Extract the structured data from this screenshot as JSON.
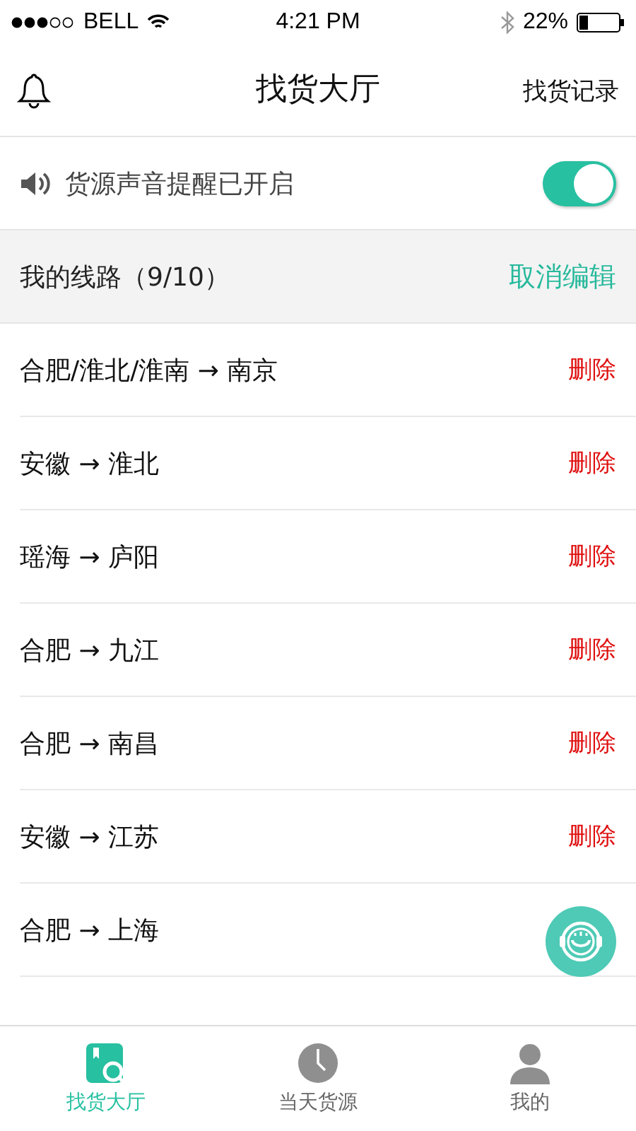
{
  "status_bar": {
    "carrier": "BELL",
    "time": "4:21 PM",
    "battery": "22%"
  },
  "nav": {
    "title": "找货大厅",
    "action": "找货记录"
  },
  "sound_setting": {
    "label": "货源声音提醒已开启",
    "on": true
  },
  "routes_header": {
    "title": "我的线路（9/10）",
    "action": "取消编辑"
  },
  "routes": [
    {
      "name": "合肥/淮北/淮南 → 南京",
      "delete": "删除"
    },
    {
      "name": "安徽 → 淮北",
      "delete": "删除"
    },
    {
      "name": "瑶海 → 庐阳",
      "delete": "删除"
    },
    {
      "name": "合肥 → 九江",
      "delete": "删除"
    },
    {
      "name": "合肥 → 南昌",
      "delete": "删除"
    },
    {
      "name": "安徽 → 江苏",
      "delete": "删除"
    },
    {
      "name": "合肥 → 上海"
    }
  ],
  "tabs": [
    {
      "label": "找货大厅",
      "selected": true,
      "kind": "search"
    },
    {
      "label": "当天货源",
      "selected": false,
      "kind": "clock"
    },
    {
      "label": "我的",
      "selected": false,
      "kind": "person"
    }
  ]
}
